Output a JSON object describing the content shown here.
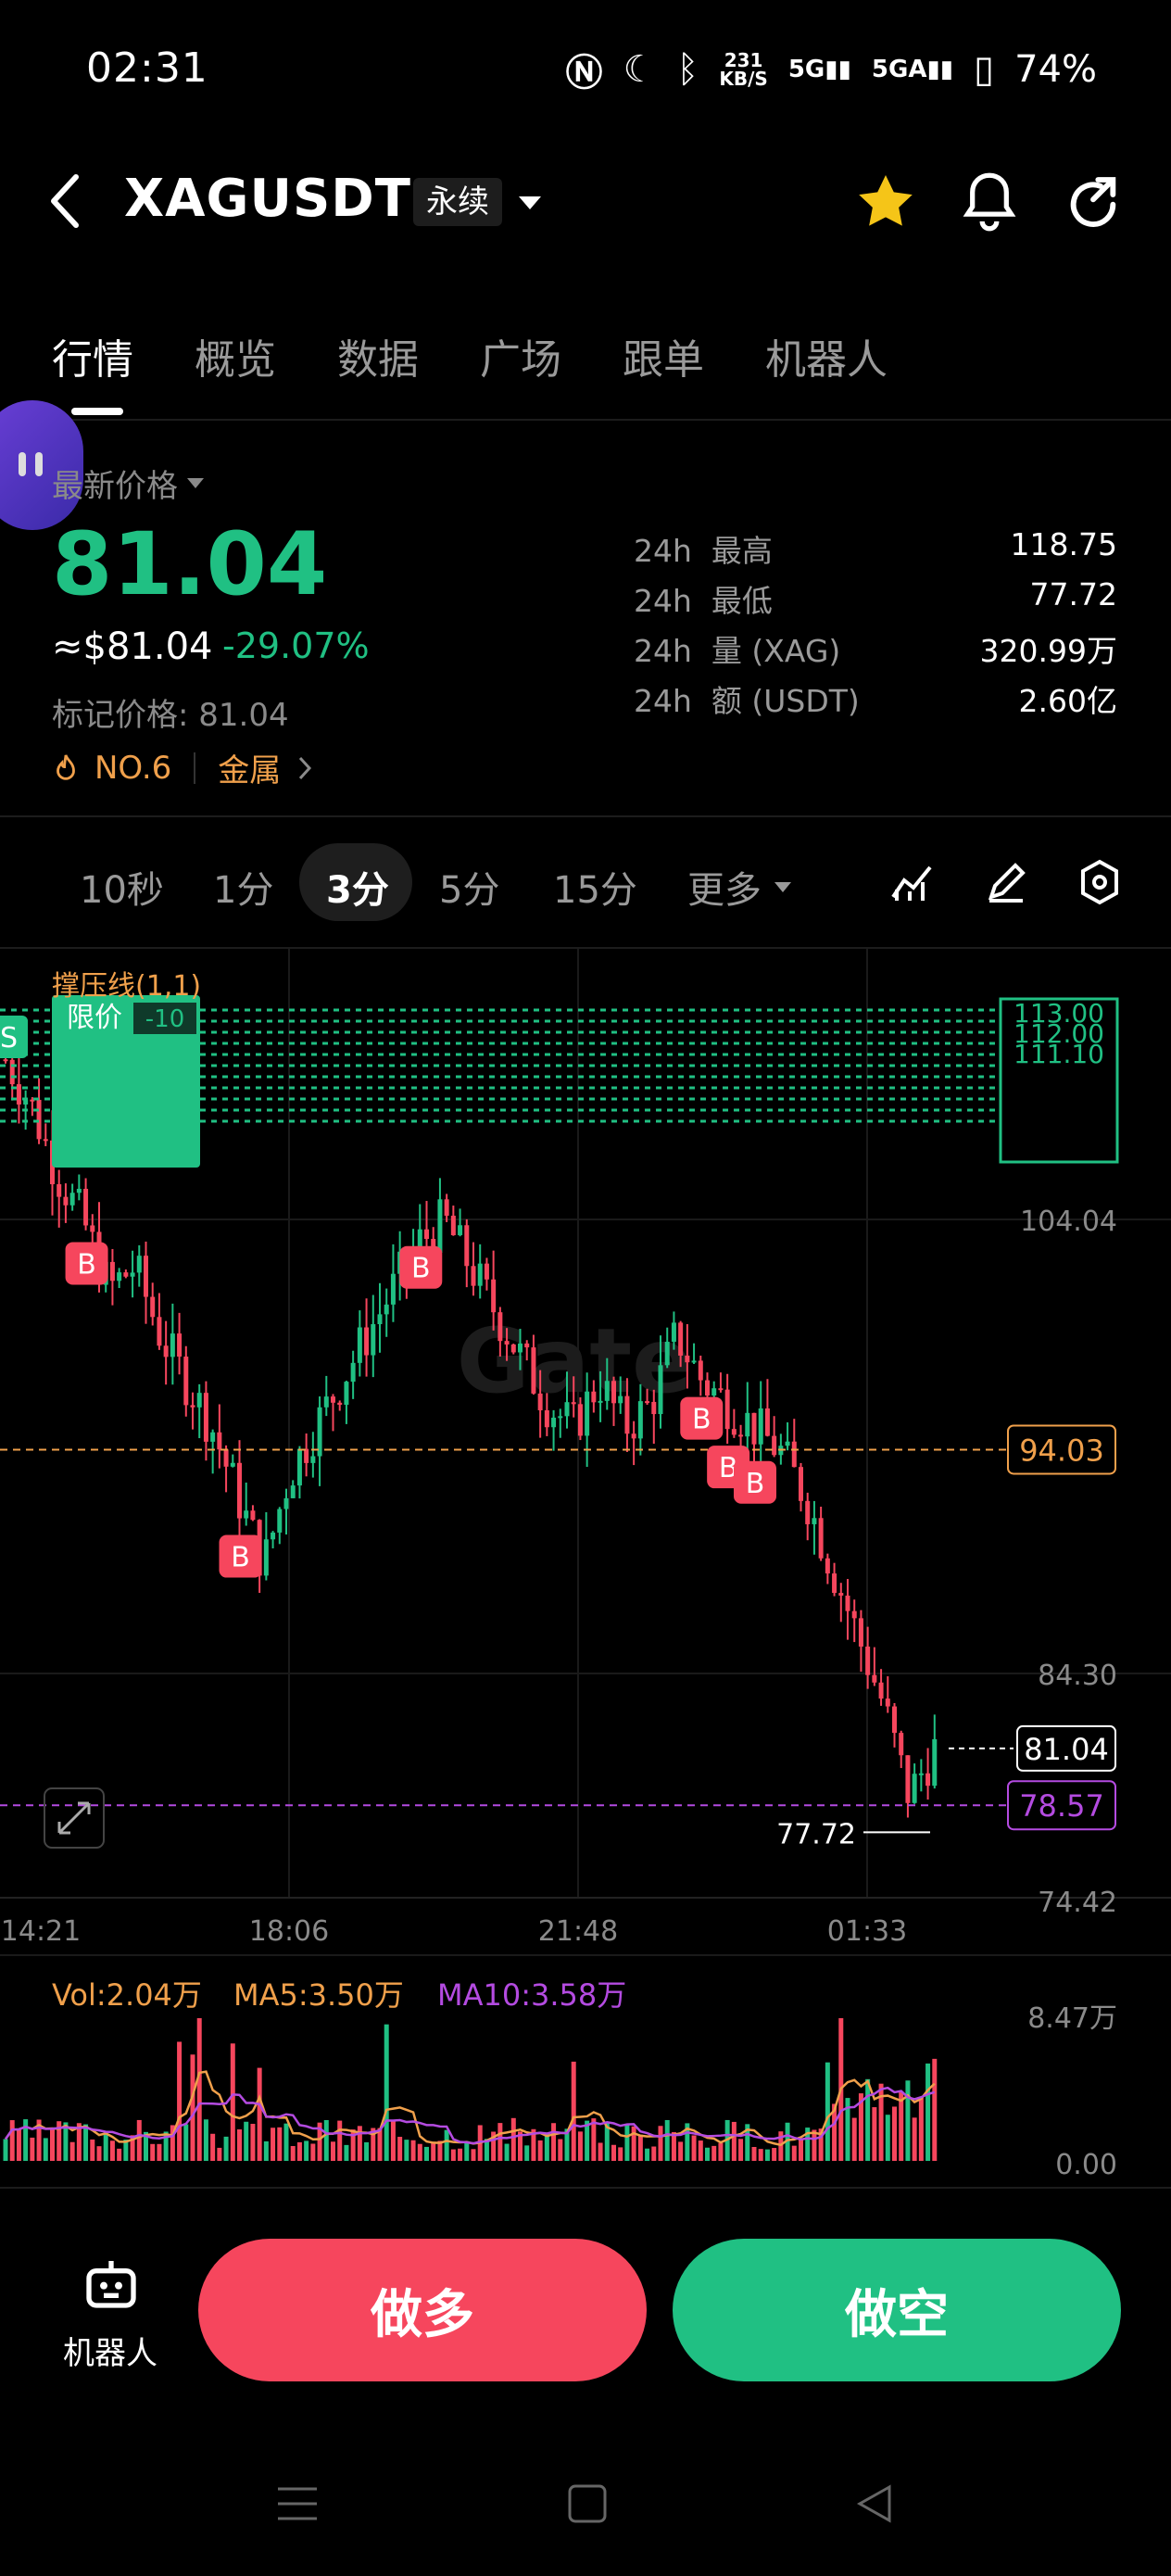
{
  "status": {
    "time": "02:31",
    "speed_top": "231",
    "speed_unit": "KB/S",
    "net1": "5G",
    "net2": "5GA",
    "battery": "74%"
  },
  "header": {
    "pair": "XAGUSDT",
    "contract_type": "永续"
  },
  "tabs": [
    "行情",
    "概览",
    "数据",
    "广场",
    "跟单",
    "机器人"
  ],
  "price": {
    "latest_label": "最新价格",
    "last": "81.04",
    "usd": "≈$81.04",
    "change": "-29.07%",
    "mark": "标记价格: 81.04",
    "rank": "NO.6",
    "category": "金属"
  },
  "stats": [
    {
      "k1": "24h",
      "k2": "最高",
      "v": "118.75"
    },
    {
      "k1": "24h",
      "k2": "最低",
      "v": "77.72"
    },
    {
      "k1": "24h",
      "k2": "量 (XAG)",
      "v": "320.99万"
    },
    {
      "k1": "24h",
      "k2": "额 (USDT)",
      "v": "2.60亿"
    }
  ],
  "intervals": [
    "10秒",
    "1分",
    "3分",
    "5分",
    "15分",
    "更多"
  ],
  "active_interval": "3分",
  "colors": {
    "up": "#20c083",
    "down": "#f6465d",
    "accent": "#f0a04b",
    "ma10": "#b44be1",
    "bg": "#000000"
  },
  "chart_data": {
    "type": "candlestick",
    "indicator_label": "撑压线(1,1)",
    "order_chip": "限价",
    "order_qty": "-10",
    "order_levels": [
      "113.00",
      "112.00",
      "111.10"
    ],
    "y_ticks": [
      "104.04",
      "84.30",
      "74.42"
    ],
    "x_ticks": [
      "14:21",
      "18:06",
      "21:48",
      "01:33"
    ],
    "support_line": {
      "value": 94.03,
      "label": "94.03"
    },
    "last_price": {
      "value": 81.04,
      "label": "81.04"
    },
    "mark_line": {
      "value": 78.57,
      "label": "78.57"
    },
    "low_marker": {
      "value": 77.72,
      "label": "77.72"
    },
    "close_path_description_values": [
      111,
      109,
      106,
      104,
      101,
      102,
      99,
      97,
      95,
      92,
      89,
      93,
      95,
      97,
      99,
      101,
      103,
      104,
      102,
      100,
      98,
      96,
      95,
      97,
      95,
      96,
      99,
      97,
      96,
      95,
      94,
      92,
      89,
      86,
      83,
      79,
      81
    ],
    "markers": [
      {
        "label": "B",
        "time_index": 3
      },
      {
        "label": "B",
        "time_index": 9
      },
      {
        "label": "B",
        "time_index": 16
      },
      {
        "label": "B",
        "time_index": 27
      },
      {
        "label": "B",
        "time_index": 28
      },
      {
        "label": "B",
        "time_index": 29
      }
    ],
    "volume": {
      "vol_label": "Vol:2.04万",
      "ma5_label": "MA5:3.50万",
      "ma10_label": "MA10:3.58万",
      "y_top": "8.47万",
      "y_bottom": "0.00"
    }
  },
  "actions": {
    "robot": "机器人",
    "long": "做多",
    "short": "做空"
  }
}
